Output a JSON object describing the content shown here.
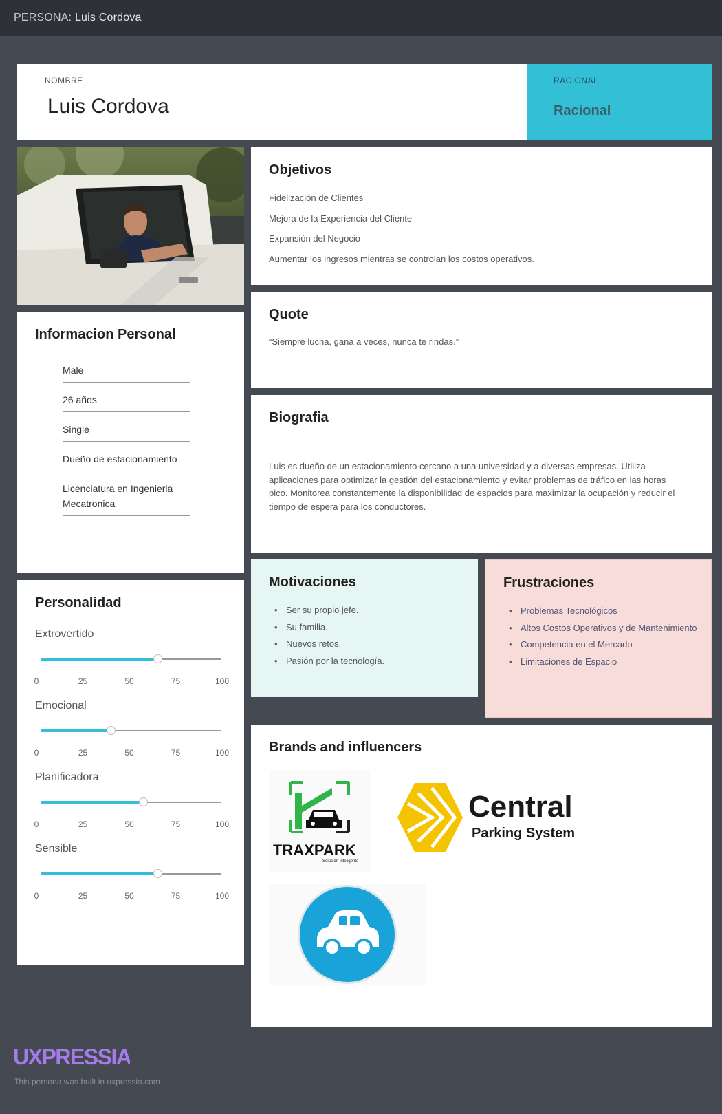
{
  "header": {
    "prefix": "PERSONA:",
    "name": "Luis Cordova"
  },
  "name_section": {
    "label": "NOMBRE",
    "value": "Luis Cordova"
  },
  "type_section": {
    "label": "RACIONAL",
    "value": "Racional"
  },
  "personal_info": {
    "title": "Informacion Personal",
    "items": [
      "Male",
      "26 años",
      "Single",
      "Dueño de estacionamiento",
      "Licenciatura en Ingenieria Mecatronica"
    ]
  },
  "personality": {
    "title": "Personalidad",
    "ticks": [
      "0",
      "25",
      "50",
      "75",
      "100"
    ],
    "traits": [
      {
        "name": "Extrovertido",
        "value": 65
      },
      {
        "name": "Emocional",
        "value": 39
      },
      {
        "name": "Planificadora",
        "value": 57
      },
      {
        "name": "Sensible",
        "value": 65
      }
    ]
  },
  "objectives": {
    "title": "Objetivos",
    "items": [
      "Fidelización de Clientes",
      "Mejora de la Experiencia del Cliente",
      "Expansión del Negocio",
      "Aumentar los ingresos mientras se controlan los costos operativos."
    ]
  },
  "quote": {
    "title": "Quote",
    "text": "“Siempre lucha, gana a veces, nunca te rindas.”"
  },
  "biography": {
    "title": "Biografia",
    "text": "Luis es dueño de un estacionamiento cercano a una universidad y a diversas empresas. Utiliza aplicaciones para optimizar la gestión del estacionamiento y evitar problemas de tráfico en las horas pico. Monitorea constantemente la disponibilidad de espacios para maximizar la ocupación y reducir el tiempo de espera para los conductores."
  },
  "motivations": {
    "title": "Motivaciones",
    "items": [
      "Ser su propio jefe.",
      "Su familia.",
      "Nuevos retos.",
      "Pasión por la tecnología."
    ]
  },
  "frustrations": {
    "title": "Frustraciones",
    "items": [
      "Problemas Tecnológicos",
      "Altos Costos Operativos y de Mantenimiento",
      "Competencia en el Mercado",
      "Limitaciones de Espacio"
    ]
  },
  "brands": {
    "title": "Brands and influencers",
    "logos": [
      {
        "name": "traxpark-logo",
        "text": "TRAXPARK",
        "tagline": "Solución Inteligente"
      },
      {
        "name": "central-parking-logo",
        "text": "Central",
        "tagline": "Parking System"
      },
      {
        "name": "car-app-logo"
      }
    ]
  },
  "footer": {
    "brand": "UXPRESSIA",
    "note": "This persona was built in uxpressia.com"
  },
  "colors": {
    "accent": "#33bfd6",
    "background": "#454952",
    "topbar": "#2e3138",
    "motivation_bg": "#e5f6f3",
    "frustration_bg": "#f8dcd9",
    "brand_purple": "#a57bea"
  }
}
